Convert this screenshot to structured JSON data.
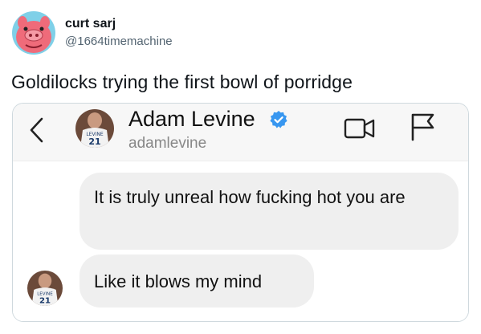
{
  "tweet": {
    "display_name": "curt sarj",
    "handle": "@1664timemachine",
    "text": "Goldilocks trying the first bowl of porridge",
    "avatar_icon": "cartoon-pig-avatar"
  },
  "dm": {
    "contact_name": "Adam Levine",
    "contact_handle": "adamlevine",
    "jersey_label": "LEVINE",
    "jersey_number": "21",
    "messages": [
      {
        "text": "It is truly unreal how fucking hot you are"
      },
      {
        "text": "Like it blows my mind"
      }
    ],
    "icons": {
      "back": "chevron-left-icon",
      "verified": "verified-badge-icon",
      "video": "video-call-icon",
      "flag": "flag-icon"
    },
    "colors": {
      "verified": "#3897f0",
      "bubble": "#efefef",
      "header_bg": "#f7f7f7"
    }
  }
}
